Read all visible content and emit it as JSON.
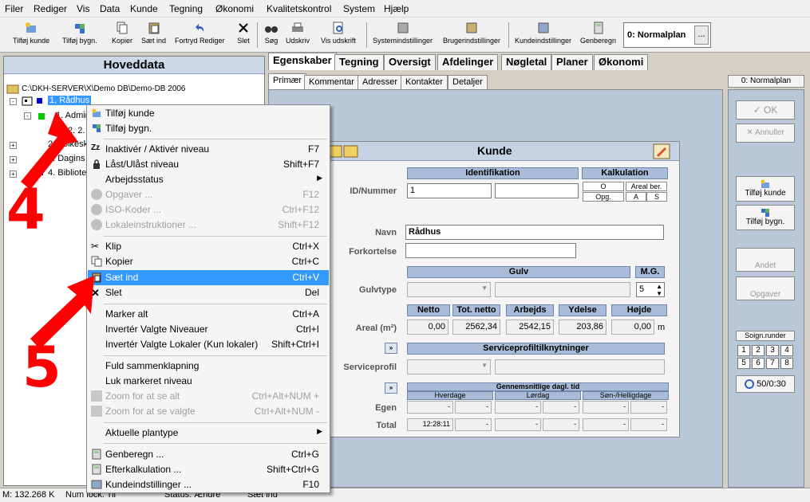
{
  "menubar": [
    "Filer",
    "Rediger",
    "Vis",
    "Data",
    "Kunde",
    "Tegning",
    "Økonomi",
    "Kvalitetskontrol",
    "System",
    "Hjælp"
  ],
  "toolbar": {
    "buttons": [
      "Tilføj kunde",
      "Tilføj bygn.",
      "Kopier",
      "Sæt ind",
      "Fortryd Rediger",
      "Slet",
      "Søg",
      "Udskriv",
      "Vis udskrift",
      "Systemindstillinger",
      "Brugerindstillinger",
      "Kundeindstillinger",
      "Genberegn"
    ],
    "plan": "0: Normalplan",
    "plan_dots": "..."
  },
  "left": {
    "title": "Hoveddata",
    "tree": [
      "C:\\DKH-SERVER\\X\\Demo DB\\Demo-DB 2006",
      "1, Rådhus",
      "1. Admin",
      "2. 2.",
      "2. Folkesk",
      "3. Dagins",
      "4. Bibliote"
    ]
  },
  "tabs": [
    "Egenskaber",
    "Tegning",
    "Oversigt",
    "Afdelinger",
    "Nøgletal",
    "Planer",
    "Økonomi"
  ],
  "subtabs": [
    "Primær",
    "Kommentar",
    "Adresser",
    "Kontakter",
    "Detaljer"
  ],
  "form": {
    "title": "Kunde",
    "identifikation": "Identifikation",
    "kalkulation": "Kalkulation",
    "kalk_o": "O",
    "kalk_areal": "Areal ber.",
    "kalk_opg": "Opg.",
    "kalk_a": "A",
    "kalk_s": "S",
    "id_label": "ID/Nummer",
    "id_value": "1",
    "navn_label": "Navn",
    "navn_value": "Rådhus",
    "forkortelse_label": "Forkortelse",
    "gulv_header": "Gulv",
    "mg_header": "M.G.",
    "gulvtype_label": "Gulvtype",
    "mg_value": "5",
    "areal_label": "Areal (m²)",
    "areal_headers": [
      "Netto",
      "Tot. netto",
      "Arbejds",
      "Ydelse",
      "Højde"
    ],
    "areal_values": [
      "0,00",
      "2562,34",
      "2542,15",
      "203,86",
      "0,00"
    ],
    "areal_unit": "m",
    "serviceprofil_header": "Serviceprofiltilknytninger",
    "serviceprofil_label": "Serviceprofil",
    "expand_btn": "»",
    "gennem_header": "Gennemsnitlige dagl. tid",
    "day_headers": [
      "Hverdage",
      "Lørdag",
      "Søn-/Helligdage"
    ],
    "egen_label": "Egen",
    "total_label": "Total",
    "egen_values": [
      "-",
      "-",
      "-",
      "-",
      "-",
      "-"
    ],
    "total_values": [
      "12:28:11",
      "-",
      "-",
      "-",
      "-",
      "-"
    ]
  },
  "right": {
    "plan": "0: Normalplan",
    "ok": "OK",
    "annuller": "Annuller",
    "tilfoj_kunde": "Tilføj kunde",
    "tilfoj_bygn": "Tilføj bygn.",
    "andet": "Andet",
    "opgaver": "Opgaver",
    "soign": "Soign.runder",
    "numbers": [
      "1",
      "2",
      "3",
      "4",
      "5",
      "6",
      "7",
      "8"
    ],
    "counter": "50/0:30"
  },
  "status": [
    "M: 132.268 K",
    "Num lock: Til",
    "Status: Ændre",
    "Sæt ind"
  ],
  "context_menu": [
    {
      "label": "Tilføj kunde",
      "key": ""
    },
    {
      "label": "Tilføj bygn.",
      "key": ""
    },
    {
      "label": "Inaktivér / Aktivér niveau",
      "key": "F7"
    },
    {
      "label": "Låst/Ulåst niveau",
      "key": "Shift+F7"
    },
    {
      "label": "Arbejdsstatus",
      "key": ""
    },
    {
      "label": "Opgaver ...",
      "key": "F12"
    },
    {
      "label": "ISO-Koder ...",
      "key": "Ctrl+F12"
    },
    {
      "label": "Lokaleinstruktioner ...",
      "key": "Shift+F12"
    },
    {
      "label": "Klip",
      "key": "Ctrl+X"
    },
    {
      "label": "Kopier",
      "key": "Ctrl+C"
    },
    {
      "label": "Sæt ind",
      "key": "Ctrl+V"
    },
    {
      "label": "Slet",
      "key": "Del"
    },
    {
      "label": "Marker alt",
      "key": "Ctrl+A"
    },
    {
      "label": "Invertér Valgte Niveauer",
      "key": "Ctrl+I"
    },
    {
      "label": "Invertér Valgte Lokaler (Kun lokaler)",
      "key": "Shift+Ctrl+I"
    },
    {
      "label": "Fuld sammenklapning",
      "key": ""
    },
    {
      "label": "Luk markeret niveau",
      "key": ""
    },
    {
      "label": "Zoom for at se alt",
      "key": "Ctrl+Alt+NUM +"
    },
    {
      "label": "Zoom for at se valgte",
      "key": "Ctrl+Alt+NUM -"
    },
    {
      "label": "Aktuelle plantype",
      "key": ""
    },
    {
      "label": "Genberegn ...",
      "key": "Ctrl+G"
    },
    {
      "label": "Efterkalkulation ...",
      "key": "Shift+Ctrl+G"
    },
    {
      "label": "Kundeindstillinger ...",
      "key": "F10"
    }
  ],
  "annotations": [
    "4",
    "5"
  ],
  "colors": {
    "highlight": "#3399ff",
    "annotation": "#ff0000",
    "header": "#a8bcd8"
  }
}
